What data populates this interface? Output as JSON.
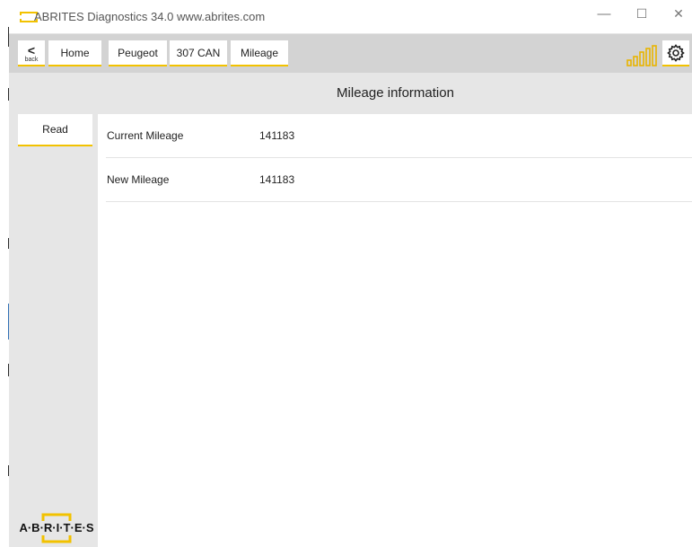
{
  "window": {
    "title": "ABRITES Diagnostics 34.0   www.abrites.com",
    "controls": {
      "minimize": "—",
      "maximize": "☐",
      "close": "✕"
    }
  },
  "toolbar": {
    "back_label": "back",
    "breadcrumbs": [
      "Home",
      "Peugeot",
      "307 CAN",
      "Mileage"
    ]
  },
  "content": {
    "heading": "Mileage information"
  },
  "sidebar": {
    "read_label": "Read"
  },
  "mileage": {
    "rows": [
      {
        "label": "Current Mileage",
        "value": "141183"
      },
      {
        "label": "New Mileage",
        "value": "141183"
      }
    ]
  },
  "logo": {
    "text": "A·B·R·I·T·E·S"
  },
  "colors": {
    "accent": "#f2c200",
    "toolbar_bg": "#d3d3d3",
    "panel_bg": "#e6e6e6"
  },
  "icons": [
    "app-icon",
    "back-chevron-icon",
    "signal-strength-icon",
    "gear-icon"
  ]
}
